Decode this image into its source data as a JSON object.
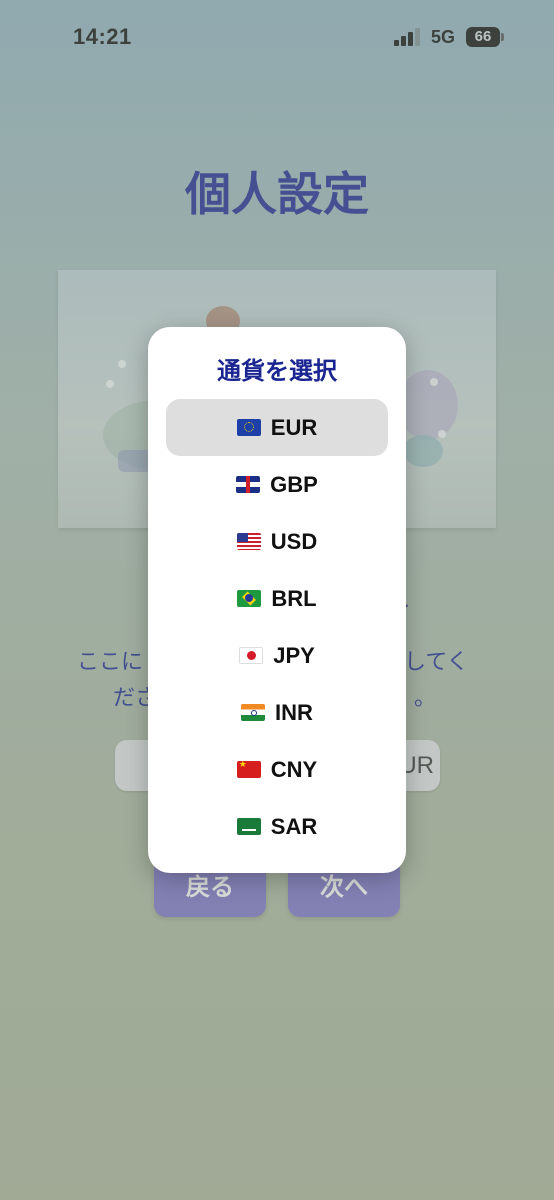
{
  "status_bar": {
    "time": "14:21",
    "network": "5G",
    "battery": "66"
  },
  "page": {
    "title": "個人設定",
    "description_line1_left": "ここに",
    "description_line1_right": "してく",
    "description_line2_left": "ださ",
    "description_line2_right": "。",
    "currency_value": "EUR",
    "back_label": "戻る",
    "next_label": "次へ"
  },
  "modal": {
    "title": "通貨を選択",
    "selected": "EUR",
    "options": [
      {
        "code": "EUR",
        "flag": "eu-flag-icon"
      },
      {
        "code": "GBP",
        "flag": "uk-flag-icon"
      },
      {
        "code": "USD",
        "flag": "us-flag-icon"
      },
      {
        "code": "BRL",
        "flag": "brazil-flag-icon"
      },
      {
        "code": "JPY",
        "flag": "japan-flag-icon"
      },
      {
        "code": "INR",
        "flag": "india-flag-icon"
      },
      {
        "code": "CNY",
        "flag": "china-flag-icon"
      },
      {
        "code": "SAR",
        "flag": "saudi-flag-icon"
      }
    ]
  },
  "colors": {
    "accent_text": "#1a2591",
    "button": "#7a70c5",
    "selected_row": "#dedede"
  }
}
